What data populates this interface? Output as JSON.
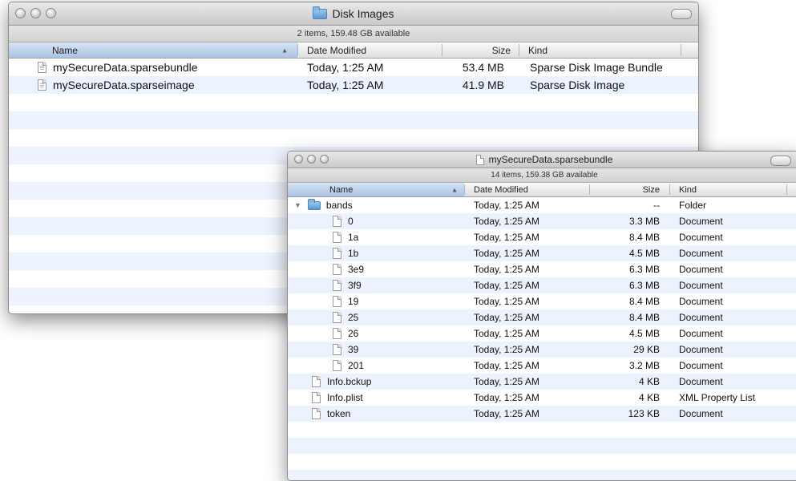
{
  "window1": {
    "title": "Disk Images",
    "status": "2 items, 159.48 GB available",
    "columns": {
      "name": "Name",
      "date": "Date Modified",
      "size": "Size",
      "kind": "Kind"
    },
    "rows": [
      {
        "name": "mySecureData.sparsebundle",
        "date": "Today, 1:25 AM",
        "size": "53.4 MB",
        "kind": "Sparse Disk Image Bundle"
      },
      {
        "name": "mySecureData.sparseimage",
        "date": "Today, 1:25 AM",
        "size": "41.9 MB",
        "kind": "Sparse Disk Image"
      }
    ]
  },
  "window2": {
    "title": "mySecureData.sparsebundle",
    "status": "14 items, 159.38 GB available",
    "columns": {
      "name": "Name",
      "date": "Date Modified",
      "size": "Size",
      "kind": "Kind"
    },
    "rows": [
      {
        "name": "bands",
        "date": "Today, 1:25 AM",
        "size": "--",
        "kind": "Folder",
        "icon": "folder-icon",
        "expanded": true
      },
      {
        "name": "0",
        "date": "Today, 1:25 AM",
        "size": "3.3 MB",
        "kind": "Document",
        "icon": "document-icon"
      },
      {
        "name": "1a",
        "date": "Today, 1:25 AM",
        "size": "8.4 MB",
        "kind": "Document",
        "icon": "document-icon"
      },
      {
        "name": "1b",
        "date": "Today, 1:25 AM",
        "size": "4.5 MB",
        "kind": "Document",
        "icon": "document-icon"
      },
      {
        "name": "3e9",
        "date": "Today, 1:25 AM",
        "size": "6.3 MB",
        "kind": "Document",
        "icon": "document-icon"
      },
      {
        "name": "3f9",
        "date": "Today, 1:25 AM",
        "size": "6.3 MB",
        "kind": "Document",
        "icon": "document-icon"
      },
      {
        "name": "19",
        "date": "Today, 1:25 AM",
        "size": "8.4 MB",
        "kind": "Document",
        "icon": "document-icon"
      },
      {
        "name": "25",
        "date": "Today, 1:25 AM",
        "size": "8.4 MB",
        "kind": "Document",
        "icon": "document-icon"
      },
      {
        "name": "26",
        "date": "Today, 1:25 AM",
        "size": "4.5 MB",
        "kind": "Document",
        "icon": "document-icon"
      },
      {
        "name": "39",
        "date": "Today, 1:25 AM",
        "size": "29 KB",
        "kind": "Document",
        "icon": "document-icon"
      },
      {
        "name": "201",
        "date": "Today, 1:25 AM",
        "size": "3.2 MB",
        "kind": "Document",
        "icon": "document-icon"
      },
      {
        "name": "Info.bckup",
        "date": "Today, 1:25 AM",
        "size": "4 KB",
        "kind": "Document",
        "icon": "document-icon"
      },
      {
        "name": "Info.plist",
        "date": "Today, 1:25 AM",
        "size": "4 KB",
        "kind": "XML Property List",
        "icon": "document-icon"
      },
      {
        "name": "token",
        "date": "Today, 1:25 AM",
        "size": "123 KB",
        "kind": "Document",
        "icon": "document-icon"
      }
    ]
  }
}
